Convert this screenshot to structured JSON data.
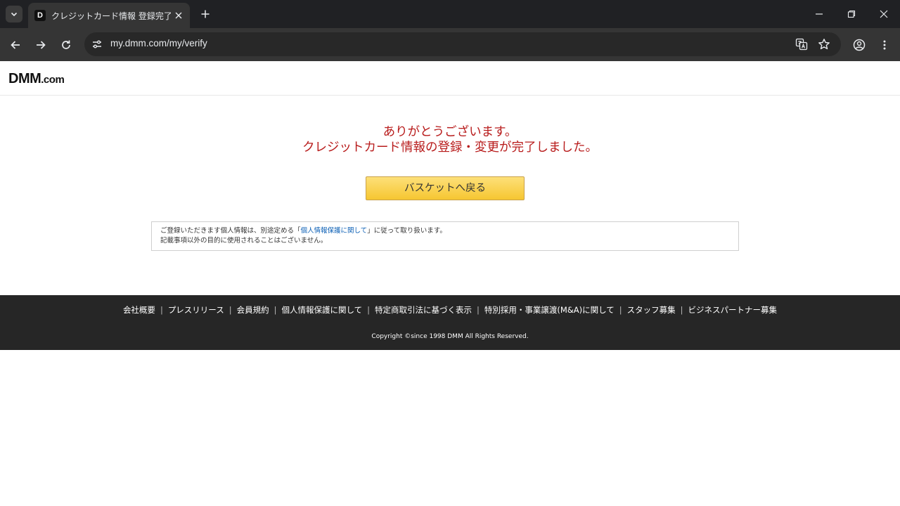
{
  "browser": {
    "tab": {
      "title": "クレジットカード情報 登録完了",
      "favicon_letter": "D"
    },
    "address_bar": {
      "url": "my.dmm.com/my/verify"
    }
  },
  "header": {
    "logo_main": "DMM",
    "logo_suffix": ".com"
  },
  "main": {
    "thanks_line1": "ありがとうございます。",
    "thanks_line2": "クレジットカード情報の登録・変更が完了しました。",
    "back_button_label": "バスケットへ戻る",
    "notice": {
      "line1_before": "ご登録いただきます個人情報は、別途定める",
      "bracket_open": "「",
      "link_text": "個人情報保護に関して",
      "bracket_close": "」",
      "line1_after": "に従って取り扱います。",
      "line2": "記載事項以外の目的に使用されることはございません。"
    }
  },
  "footer": {
    "links": [
      "会社概要",
      "プレスリリース",
      "会員規約",
      "個人情報保護に関して",
      "特定商取引法に基づく表示",
      "特別採用・事業譲渡(M&A)に関して",
      "スタッフ募集",
      "ビジネスパートナー募集"
    ],
    "separator": "|",
    "copyright": "Copyright ©since 1998 DMM All Rights Reserved."
  },
  "colors": {
    "accent_red": "#b81c1c",
    "button_yellow": "#f6c631",
    "link_blue": "#0b5fb5",
    "footer_bg": "#262626"
  }
}
